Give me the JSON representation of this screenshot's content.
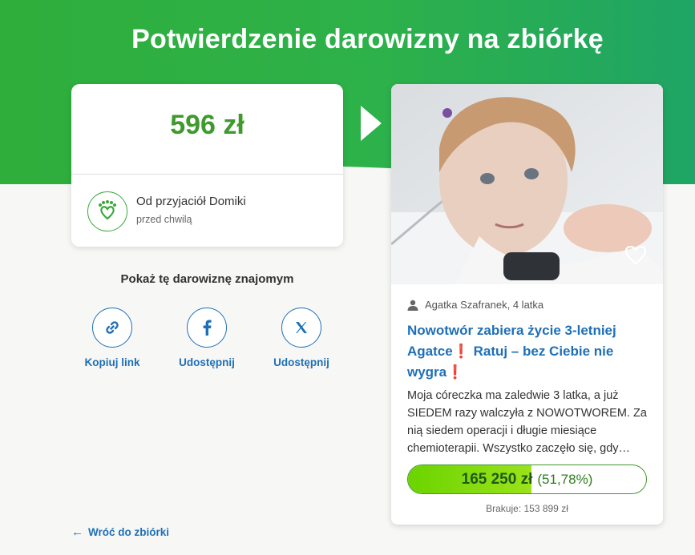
{
  "page": {
    "title": "Potwierdzenie darowizny na zbiórkę"
  },
  "donation": {
    "amount": "596 zł",
    "donor_name": "Od przyjaciół Domiki",
    "time": "przed chwilą"
  },
  "share": {
    "title": "Pokaż tę darowiznę znajomym",
    "buttons": [
      {
        "label": "Kopiuj link",
        "icon": "link-icon"
      },
      {
        "label": "Udostępnij",
        "icon": "facebook-icon"
      },
      {
        "label": "Udostępnij",
        "icon": "x-icon"
      }
    ]
  },
  "back": {
    "label": "Wróć do zbiórki"
  },
  "fundraiser": {
    "owner": "Agatka Szafranek, 4 latka",
    "title_part1": "Nowotwór zabiera życie 3-letniej Agatce",
    "title_part2": " Ratuj – bez Ciebie nie wygra",
    "exclamation": "❗",
    "description": "Moja córeczka ma zaledwie 3 latka, a już SIEDEM razy walczyła z NOWOTWOREM. Za nią siedem operacji i długie miesiące chemioterapii. Wszystko zaczęło się, gdy…",
    "raised": "165 250 zł",
    "percent": "(51,78%)",
    "progress_fraction": 0.5178,
    "missing": "Brakuje: 153 899 zł"
  },
  "colors": {
    "brand_green": "#2fae3b",
    "amount_green": "#3f9a2e",
    "link_blue": "#1e6fb8",
    "progress_fill": "#7ed600",
    "alert_red": "#e0332a"
  }
}
